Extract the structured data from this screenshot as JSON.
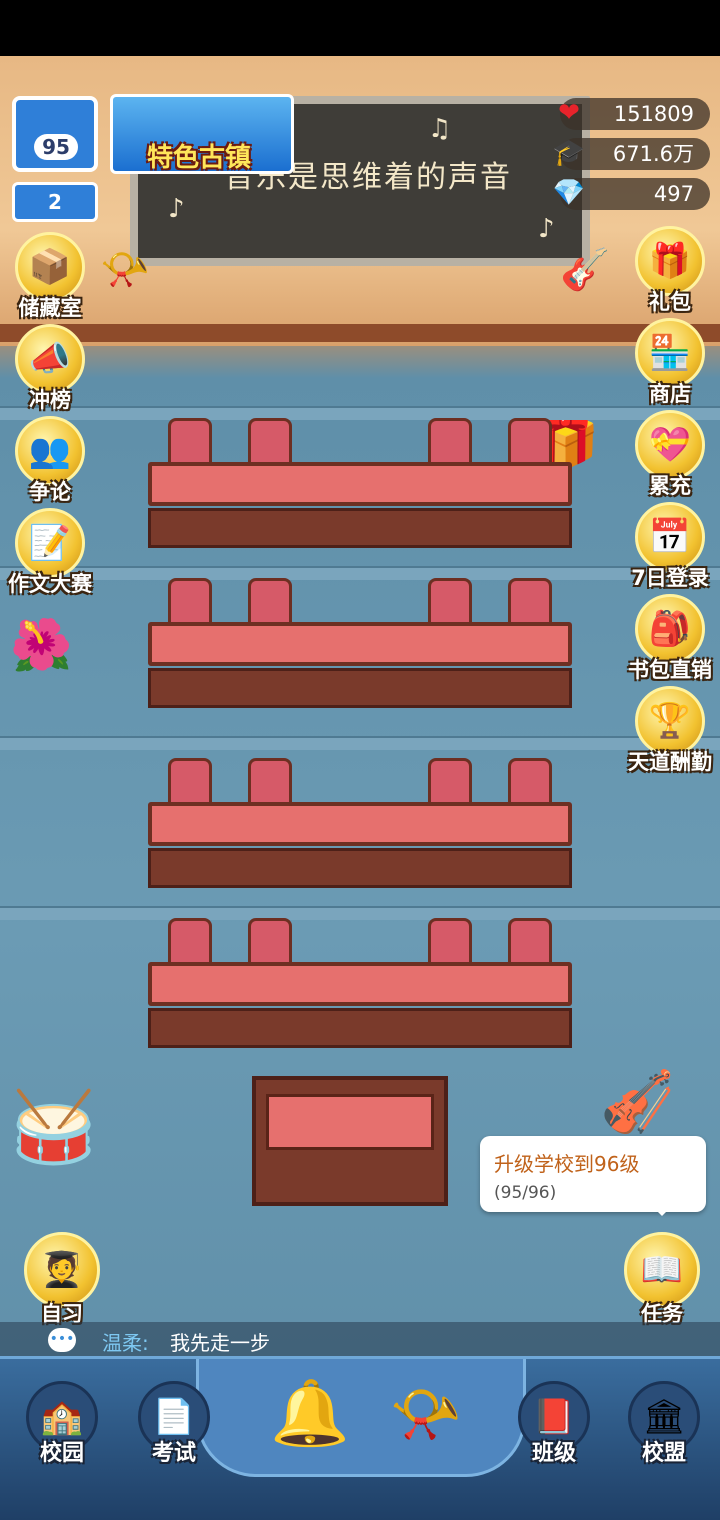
{
  "blackboard": {
    "text": "音乐是思维着的声音"
  },
  "stats": [
    {
      "icon": "heart-icon",
      "glyph": "❤",
      "value": "151809"
    },
    {
      "icon": "graduation-cap-icon",
      "glyph": "🎓",
      "value": "671.6万"
    },
    {
      "icon": "gem-icon",
      "glyph": "💎",
      "value": "497"
    }
  ],
  "school": {
    "level": "95",
    "crown_level": "2",
    "town_banner": "特色古镇"
  },
  "left_menu": [
    {
      "label": "储藏室",
      "glyph": "📦"
    },
    {
      "label": "冲榜",
      "glyph": "📣"
    },
    {
      "label": "争论",
      "glyph": "👥"
    },
    {
      "label": "作文大赛",
      "glyph": "📝"
    }
  ],
  "right_menu": [
    {
      "label": "礼包",
      "glyph": "🎁"
    },
    {
      "label": "商店",
      "glyph": "🏪"
    },
    {
      "label": "累充",
      "glyph": "💝"
    },
    {
      "label": "7日登录",
      "glyph": "📅"
    },
    {
      "label": "书包直销",
      "glyph": "🎒"
    },
    {
      "label": "天道酬勤",
      "glyph": "🏆"
    }
  ],
  "self_study": {
    "label": "自习"
  },
  "tasks": {
    "label": "任务"
  },
  "tooltip": {
    "title": "升级学校到96级",
    "progress": "(95/96)"
  },
  "chat": {
    "name": "温柔:",
    "message": "我先走一步"
  },
  "nav": [
    {
      "label": "校园",
      "glyph": "🏫"
    },
    {
      "label": "考试",
      "glyph": "📄"
    },
    {
      "label": "班级",
      "glyph": "📕"
    },
    {
      "label": "校盟",
      "glyph": "🏛"
    }
  ]
}
